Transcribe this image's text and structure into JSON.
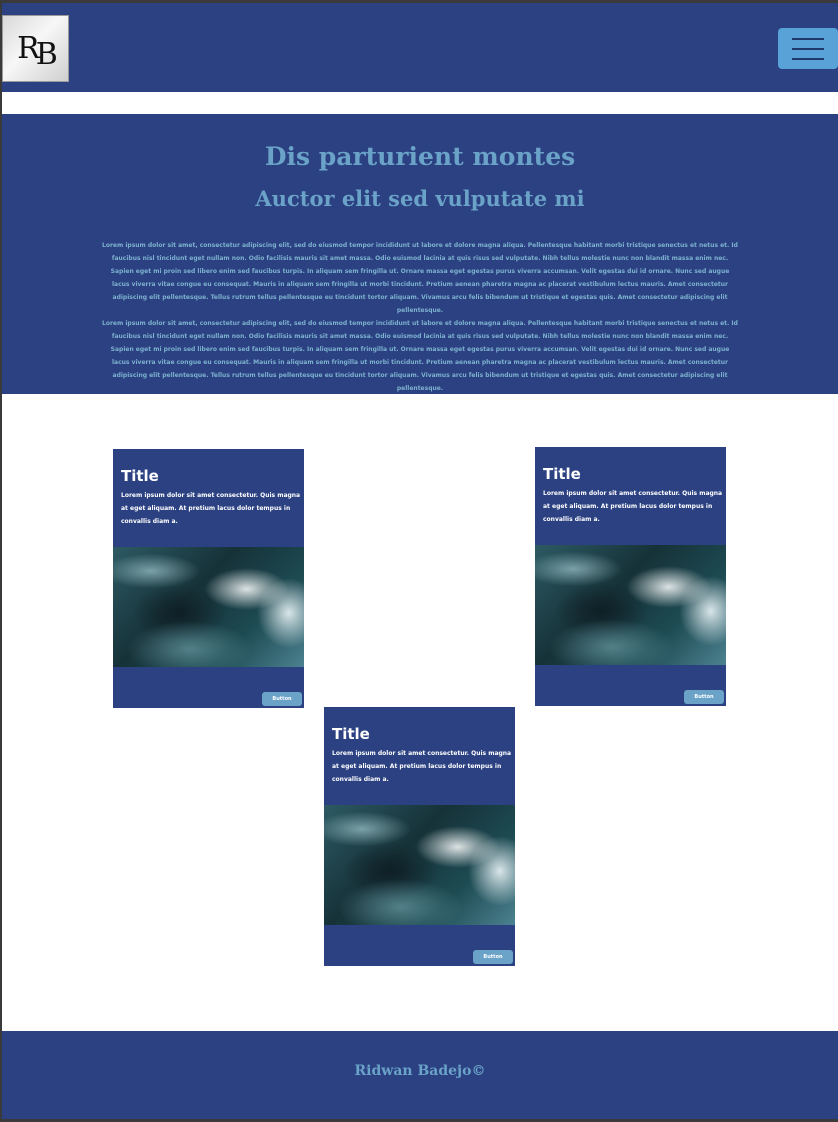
{
  "header": {
    "logo_text_r": "R",
    "logo_text_b": "B",
    "menu_icon": "hamburger-icon"
  },
  "hero": {
    "title": "Dis parturient montes",
    "subtitle": "Auctor elit sed vulputate mi",
    "paragraphs": [
      "Lorem ipsum dolor sit amet, consectetur adipiscing elit, sed do eiusmod tempor incididunt ut labore et dolore magna aliqua. Pellentesque habitant morbi tristique senectus et netus et. Id faucibus nisl tincidunt eget nullam non. Odio facilisis mauris sit amet massa. Odio euismod lacinia at quis risus sed vulputate. Nibh tellus molestie nunc non blandit massa enim nec. Sapien eget mi proin sed libero enim sed faucibus turpis. In aliquam sem fringilla ut. Ornare massa eget egestas purus viverra accumsan. Velit egestas dui id ornare. Nunc sed augue lacus viverra vitae congue eu consequat. Mauris in aliquam sem fringilla ut morbi tincidunt. Pretium aenean pharetra magna ac placerat vestibulum lectus mauris. Amet consectetur adipiscing elit pellentesque. Tellus rutrum tellus pellentesque eu tincidunt tortor aliquam. Vivamus arcu felis bibendum ut tristique et egestas quis. Amet consectetur adipiscing elit pellentesque.",
      "Lorem ipsum dolor sit amet, consectetur adipiscing elit, sed do eiusmod tempor incididunt ut labore et dolore magna aliqua. Pellentesque habitant morbi tristique senectus et netus et. Id faucibus nisl tincidunt eget nullam non. Odio facilisis mauris sit amet massa. Odio euismod lacinia at quis risus sed vulputate. Nibh tellus molestie nunc non blandit massa enim nec. Sapien eget mi proin sed libero enim sed faucibus turpis. In aliquam sem fringilla ut. Ornare massa eget egestas purus viverra accumsan. Velit egestas dui id ornare. Nunc sed augue lacus viverra vitae congue eu consequat. Mauris in aliquam sem fringilla ut morbi tincidunt. Pretium aenean pharetra magna ac placerat vestibulum lectus mauris. Amet consectetur adipiscing elit pellentesque. Tellus rutrum tellus pellentesque eu tincidunt tortor aliquam. Vivamus arcu felis bibendum ut tristique et egestas quis. Amet consectetur adipiscing elit pellentesque."
    ]
  },
  "cards": [
    {
      "title": "Title",
      "text": "Lorem ipsum dolor sit amet consectetur. Quis magna at eget aliquam. At pretium lacus dolor tempus in convallis diam a.",
      "button": "Button"
    },
    {
      "title": "Title",
      "text": "Lorem ipsum dolor sit amet consectetur. Quis magna at eget aliquam. At pretium lacus dolor tempus in convallis diam a.",
      "button": "Button"
    },
    {
      "title": "Title",
      "text": "Lorem ipsum dolor sit amet consectetur. Quis magna at eget aliquam. At pretium lacus dolor tempus in convallis diam a.",
      "button": "Button"
    }
  ],
  "footer": {
    "copyright": "Ridwan Badejo©"
  },
  "colors": {
    "primary": "#2b4182",
    "accent": "#6aa2c8",
    "menu_button": "#58a2d8"
  }
}
